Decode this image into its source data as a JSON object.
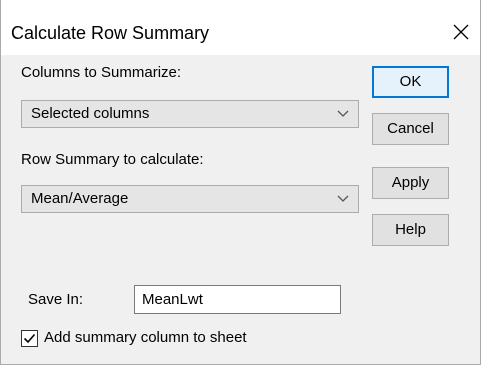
{
  "dialog": {
    "title": "Calculate Row Summary",
    "close_icon": "close-icon"
  },
  "columns_section": {
    "label": "Columns to Summarize:",
    "selected_value": "Selected columns"
  },
  "summary_section": {
    "label": "Row Summary to calculate:",
    "selected_value": "Mean/Average"
  },
  "buttons": {
    "ok": "OK",
    "cancel": "Cancel",
    "apply": "Apply",
    "help": "Help"
  },
  "save_in": {
    "label": "Save In:",
    "value": "MeanLwt"
  },
  "add_column": {
    "label": "Add summary column to sheet",
    "checked": true
  },
  "colors": {
    "accent": "#0078d7",
    "dialog_background": "#f0f0f0",
    "titlebar_background": "#ffffff"
  }
}
